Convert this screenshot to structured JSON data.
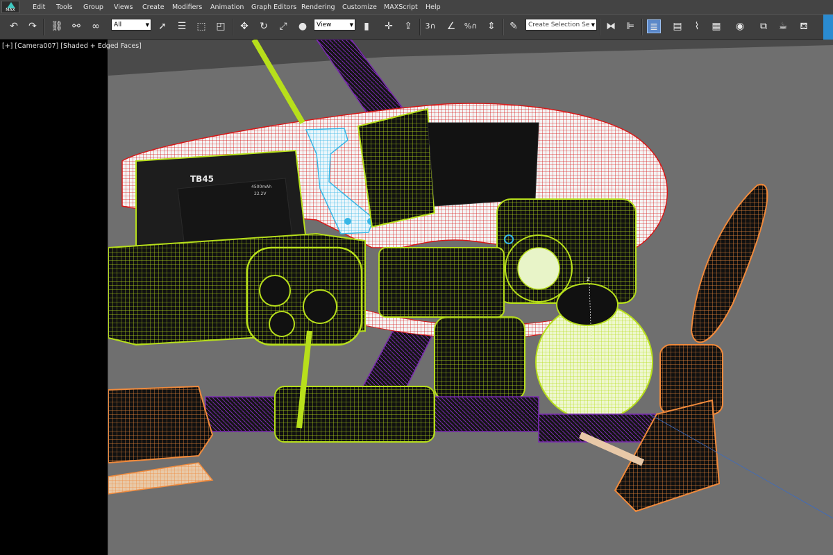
{
  "app": {
    "logo_text": "MAX"
  },
  "menu": {
    "items": [
      "Edit",
      "Tools",
      "Group",
      "Views",
      "Create",
      "Modifiers",
      "Animation",
      "Graph Editors",
      "Rendering",
      "Customize",
      "MAXScript",
      "Help"
    ]
  },
  "toolbar": {
    "selection_filter": "All",
    "reference_coord": "View",
    "selection_set_placeholder": "Create Selection Se",
    "snap_label": "3",
    "percent_snap_label": "%"
  },
  "viewport": {
    "label_plus": "[+]",
    "label_camera": "[Camera007]",
    "label_mode": "[Shaded + Edged Faces]",
    "battery_brand": "TB45",
    "battery_capacity": "4500mAh",
    "battery_voltage": "22.2V",
    "gizmo_axis": "z",
    "colors": {
      "background": "#6f6f6f",
      "wire_yellow": "#b7df1b",
      "wire_red": "#d81818",
      "wire_orange": "#f08a3c",
      "wire_purple": "#7a2ab0",
      "wire_cyan": "#38b7e6"
    }
  }
}
